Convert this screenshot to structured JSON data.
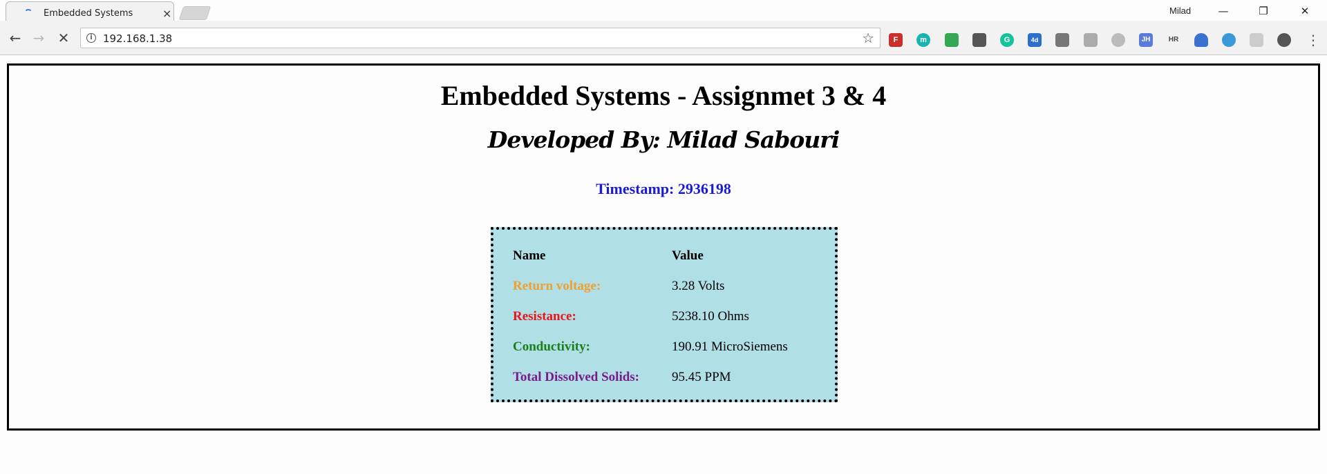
{
  "browser": {
    "tab_title": "Embedded Systems",
    "tab_close": "×",
    "profile_name": "Milad",
    "window_controls": {
      "minimize": "—",
      "restore": "❐",
      "close": "✕"
    },
    "url": "192.168.1.38",
    "extensions": [
      {
        "name": "feedly-icon",
        "label": "F",
        "color": "#c8302b"
      },
      {
        "name": "mercury-icon",
        "label": "m",
        "color": "#1bb3b0"
      },
      {
        "name": "google-icon",
        "label": "",
        "color": "#34a853"
      },
      {
        "name": "bulb-icon",
        "label": "",
        "color": "#555555"
      },
      {
        "name": "grammarly-icon",
        "label": "G",
        "color": "#15c39a"
      },
      {
        "name": "badge-ext-icon",
        "label": "4d",
        "color": "#2e6fc9"
      },
      {
        "name": "notes-icon",
        "label": "",
        "color": "#777777"
      },
      {
        "name": "copy-icon",
        "label": "",
        "color": "#aaaaaa"
      },
      {
        "name": "shield-icon",
        "label": "",
        "color": "#bbbbbb"
      },
      {
        "name": "jh-icon",
        "label": "JH",
        "color": "#5a7bd8"
      },
      {
        "name": "hr-icon",
        "label": "HR",
        "color": "#555555"
      },
      {
        "name": "cloud-icon",
        "label": "",
        "color": "#3a70d0"
      },
      {
        "name": "timer-icon",
        "label": "",
        "color": "#3a9ad9"
      },
      {
        "name": "puzzle-icon",
        "label": "",
        "color": "#cccccc"
      },
      {
        "name": "film-icon",
        "label": "",
        "color": "#555555"
      }
    ]
  },
  "page": {
    "title": "Embedded Systems - Assignmet 3 & 4",
    "subtitle": "Developed By: Milad Sabouri",
    "timestamp": "Timestamp: 2936198",
    "table": {
      "headers": [
        "Name",
        "Value"
      ],
      "rows": [
        {
          "label": "Return voltage:",
          "value": "3.28 Volts",
          "color": "#f0a030"
        },
        {
          "label": "Resistance:",
          "value": "5238.10 Ohms",
          "color": "#e8141c"
        },
        {
          "label": "Conductivity:",
          "value": "190.91 MicroSiemens",
          "color": "#1a7f1a"
        },
        {
          "label": "Total Dissolved Solids:",
          "value": "95.45 PPM",
          "color": "#7a1a8a"
        }
      ]
    }
  }
}
